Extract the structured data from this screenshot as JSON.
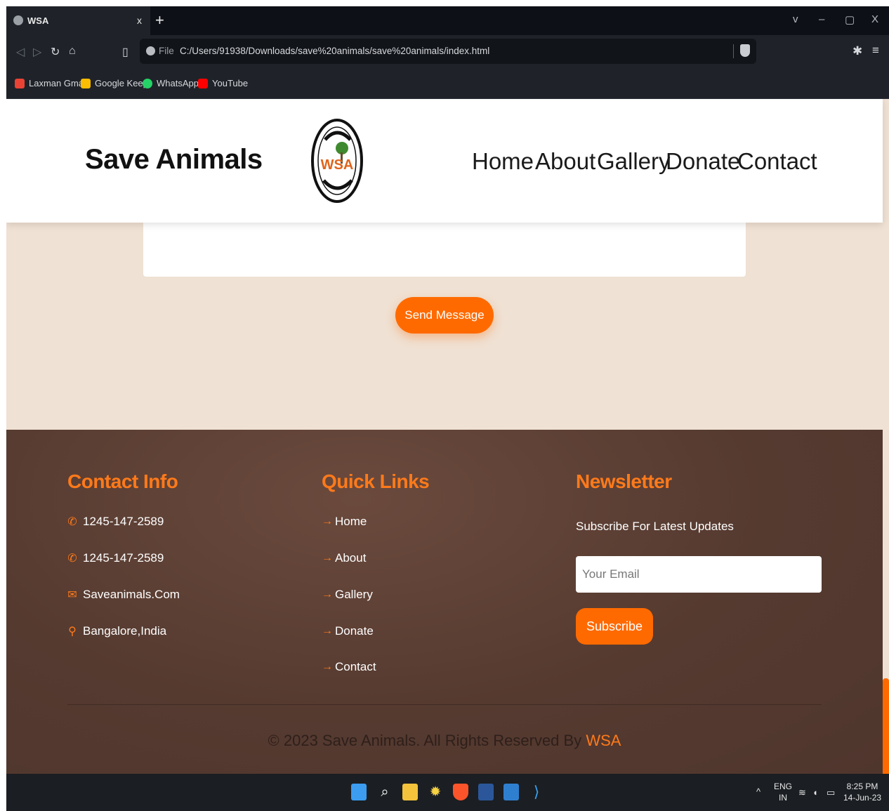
{
  "browser": {
    "tab_title": "WSA",
    "tab_close": "x",
    "new_tab": "+",
    "window_controls": [
      "v",
      "–",
      "▢",
      "X"
    ],
    "address": {
      "scheme_label": "File",
      "url": "C:/Users/91938/Downloads/save%20animals/save%20animals/index.html"
    },
    "bookmarks": [
      {
        "label": "Laxman Gmail",
        "icon": "gmail-icon",
        "color": "#ea4335"
      },
      {
        "label": "Google Keep",
        "icon": "keep-icon",
        "color": "#fbbc04"
      },
      {
        "label": "WhatsApp",
        "icon": "whatsapp-icon",
        "color": "#25d366"
      },
      {
        "label": "YouTube",
        "icon": "youtube-icon",
        "color": "#ff0000"
      }
    ]
  },
  "site": {
    "brand": "Save Animals",
    "logo_text": {
      "top": "WE SAVE ANIMALS",
      "middle": "WSA",
      "bottom": "WELFARE TRUST"
    },
    "nav": [
      "Home",
      "About",
      "Gallery",
      "Donate",
      "Contact"
    ],
    "contact_form": {
      "send_label": "Send Message"
    },
    "footer": {
      "contact": {
        "heading": "Contact Info",
        "items": [
          {
            "icon": "phone-icon",
            "text": "1245-147-2589"
          },
          {
            "icon": "phone-icon",
            "text": "1245-147-2589"
          },
          {
            "icon": "envelope-icon",
            "text": "Saveanimals.Com"
          },
          {
            "icon": "map-pin-icon",
            "text": "Bangalore,India"
          }
        ]
      },
      "quick_links": {
        "heading": "Quick Links",
        "items": [
          "Home",
          "About",
          "Gallery",
          "Donate",
          "Contact"
        ]
      },
      "newsletter": {
        "heading": "Newsletter",
        "subtitle": "Subscribe For Latest Updates",
        "email_placeholder": "Your Email",
        "button": "Subscribe"
      },
      "copyright": "© 2023 Save Animals. All Rights Reserved By ",
      "copyright_brand": "WSA"
    },
    "accent_color": "#ff6a00"
  },
  "taskbar": {
    "language": {
      "line1": "ENG",
      "line2": "IN"
    },
    "time": "8:25 PM",
    "date": "14-Jun-23"
  }
}
